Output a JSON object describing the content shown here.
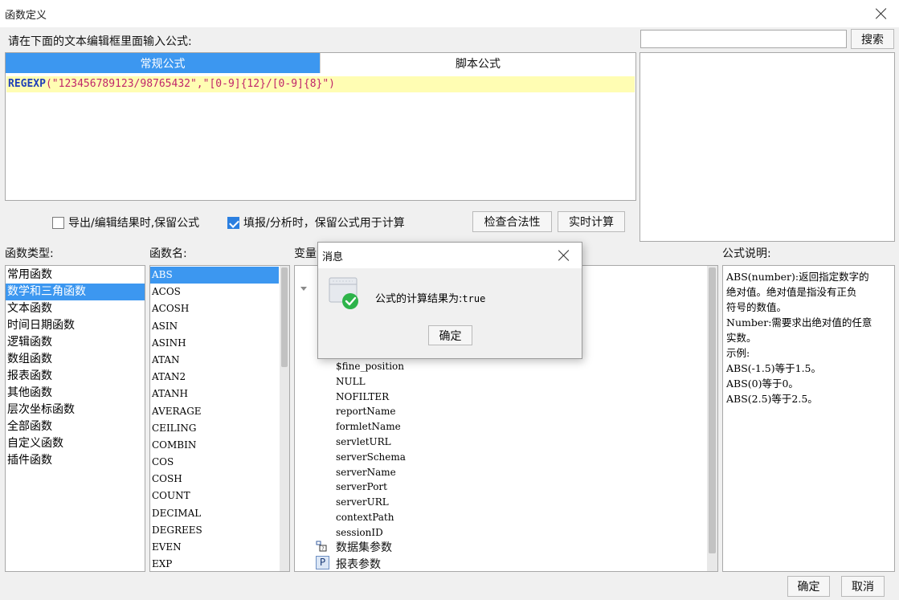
{
  "window": {
    "title": "函数定义"
  },
  "editor": {
    "prompt": "请在下面的文本编辑框里面输入公式:",
    "tabs": [
      {
        "label": "常规公式",
        "active": true
      },
      {
        "label": "脚本公式",
        "active": false
      }
    ],
    "formula_function": "REGEXP",
    "formula_args": "(\"123456789123/98765432\",\"[0-9]{12}/[0-9]{8}\")"
  },
  "search": {
    "input_value": "",
    "button_label": "搜索"
  },
  "options": {
    "export_keep_formula": {
      "label": "导出/编辑结果时,保留公式",
      "checked": false
    },
    "fill_keep_formula": {
      "label": "填报/分析时，保留公式用于计算",
      "checked": true
    },
    "check_button": "检查合法性",
    "realtime_button": "实时计算"
  },
  "function_types": {
    "header": "函数类型:",
    "items": [
      "常用函数",
      "数学和三角函数",
      "文本函数",
      "时间日期函数",
      "逻辑函数",
      "数组函数",
      "报表函数",
      "其他函数",
      "层次坐标函数",
      "全部函数",
      "自定义函数",
      "插件函数"
    ],
    "selected_index": 1
  },
  "function_names": {
    "header": "函数名:",
    "items": [
      "ABS",
      "ACOS",
      "ACOSH",
      "ASIN",
      "ASINH",
      "ATAN",
      "ATAN2",
      "ATANH",
      "AVERAGE",
      "CEILING",
      "COMBIN",
      "COS",
      "COSH",
      "COUNT",
      "DECIMAL",
      "DEGREES",
      "EVEN",
      "EXP"
    ],
    "selected_index": 0
  },
  "variables": {
    "header": "变量",
    "items": [
      "$fine_position",
      "NULL",
      "NOFILTER",
      "reportName",
      "formletName",
      "servletURL",
      "serverSchema",
      "serverName",
      "serverPort",
      "serverURL",
      "contextPath",
      "sessionID"
    ],
    "group_dataset_params": "数据集参数",
    "group_report_params": "报表参数",
    "report_params_icon_text": "P"
  },
  "description": {
    "header": "公式说明:",
    "lines": [
      "ABS(number):返回指定数字的",
      "绝对值。绝对值是指没有正负",
      "符号的数值。",
      "Number:需要求出绝对值的任意",
      "实数。",
      "示例:",
      "ABS(-1.5)等于1.5。",
      "ABS(0)等于0。",
      "ABS(2.5)等于2.5。"
    ]
  },
  "footer": {
    "ok": "确定",
    "cancel": "取消"
  },
  "message_dialog": {
    "title": "消息",
    "text": "公式的计算结果为:",
    "result": "true",
    "ok": "确定"
  },
  "colors": {
    "accent": "#3c97f0",
    "formula_highlight": "#fffdb3",
    "keyword": "#1f3fb8",
    "string": "#c0256a",
    "success": "#2db34a"
  }
}
